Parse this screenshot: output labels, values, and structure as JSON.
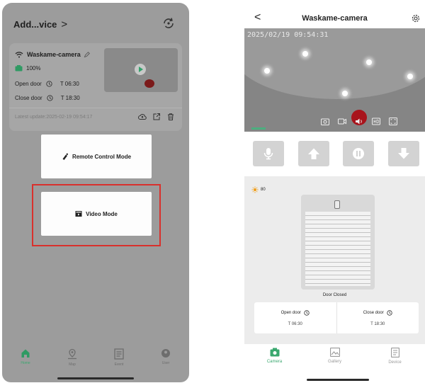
{
  "left_screen": {
    "header": {
      "title": "Add...vice",
      "chevron": ">"
    },
    "device_card": {
      "name": "Waskame-camera",
      "battery": "100%",
      "open_door_label": "Open door",
      "open_door_time": "T 06:30",
      "close_door_label": "Close door",
      "close_door_time": "T 18:30",
      "latest_update": "Latest update:2025-02-19 09:54:17"
    },
    "modes": {
      "remote_label": "Remote Control Mode",
      "video_label": "Video Mode"
    },
    "tabs": [
      {
        "label": "Home",
        "icon": "home-icon"
      },
      {
        "label": "Map",
        "icon": "map-icon"
      },
      {
        "label": "Event",
        "icon": "event-icon"
      },
      {
        "label": "User",
        "icon": "user-icon"
      }
    ],
    "colors": {
      "accent": "#3aa86f",
      "highlight": "#d9302c",
      "overlay": "#9c9c9c"
    }
  },
  "right_screen": {
    "header": {
      "back": "<",
      "title": "Waskame-camera"
    },
    "camera": {
      "timestamp": "2025/02/19 09:54:31"
    },
    "status": {
      "light_value": "80",
      "door_status": "Door Closed",
      "open_door_label": "Open door",
      "open_door_time": "T 06:30",
      "close_door_label": "Close door",
      "close_door_time": "T 18:30"
    },
    "tabs": [
      {
        "label": "Camera",
        "icon": "camera-icon"
      },
      {
        "label": "Gallery",
        "icon": "gallery-icon"
      },
      {
        "label": "Device",
        "icon": "device-icon"
      }
    ]
  }
}
